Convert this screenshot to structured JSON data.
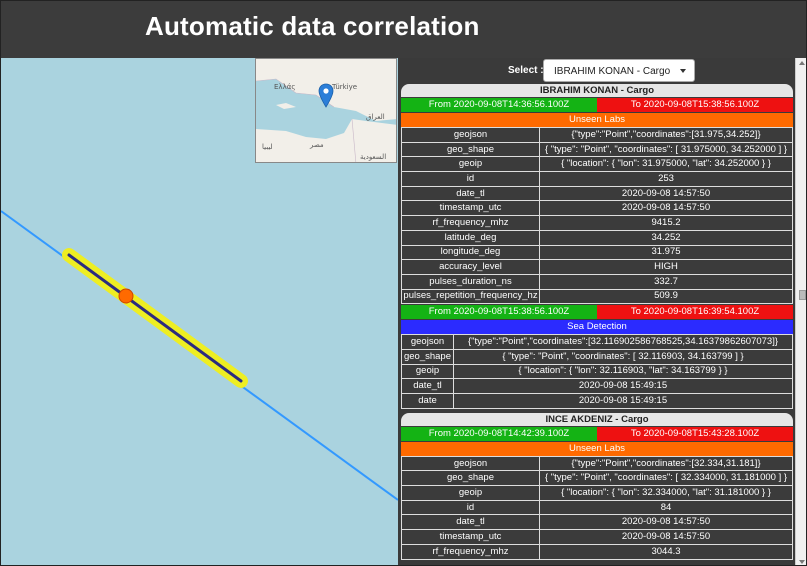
{
  "title": "Automatic data correlation",
  "select": {
    "label": "Select :",
    "value": "IBRAHIM KONAN - Cargo"
  },
  "inset_labels": {
    "greece": "Ελλάς",
    "turkey": "Türkiye",
    "iraq": "العراق",
    "libya": "ليبيا",
    "egypt": "مصر",
    "saudi": "السعودية"
  },
  "colors": {
    "from": "#14b314",
    "to": "#ee1111",
    "unseen_labs": "#ff6a00",
    "sea_detection": "#2b2bff",
    "track": "#3399ff"
  },
  "cards": [
    {
      "title": "IBRAHIM KONAN - Cargo",
      "from": "From 2020-09-08T14:36:56.100Z",
      "to": "To 2020-09-08T15:38:56.100Z",
      "source": "Unseen Labs",
      "rows": [
        [
          "geojson",
          "{\"type\":\"Point\",\"coordinates\":[31.975,34.252]}"
        ],
        [
          "geo_shape",
          "{ \"type\": \"Point\", \"coordinates\": [ 31.975000, 34.252000 ] }"
        ],
        [
          "geoip",
          "{ \"location\": { \"lon\": 31.975000, \"lat\": 34.252000 } }"
        ],
        [
          "id",
          "253"
        ],
        [
          "date_tl",
          "2020-09-08 14:57:50"
        ],
        [
          "timestamp_utc",
          "2020-09-08 14:57:50"
        ],
        [
          "rf_frequency_mhz",
          "9415.2"
        ],
        [
          "latitude_deg",
          "34.252"
        ],
        [
          "longitude_deg",
          "31.975"
        ],
        [
          "accuracy_level",
          "HIGH"
        ],
        [
          "pulses_duration_ns",
          "332.7"
        ],
        [
          "pulses_repetition_frequency_hz",
          "509.9"
        ]
      ],
      "from2": "From 2020-09-08T15:38:56.100Z",
      "to2": "To 2020-09-08T16:39:54.100Z",
      "source2": "Sea Detection",
      "rows2": [
        [
          "geojson",
          "{\"type\":\"Point\",\"coordinates\":[32.116902586768525,34.16379862607073]}"
        ],
        [
          "geo_shape",
          "{ \"type\": \"Point\", \"coordinates\": [ 32.116903, 34.163799 ] }"
        ],
        [
          "geoip",
          "{ \"location\": { \"lon\": 32.116903, \"lat\": 34.163799 } }"
        ],
        [
          "date_tl",
          "2020-09-08 15:49:15"
        ],
        [
          "date",
          "2020-09-08 15:49:15"
        ]
      ]
    },
    {
      "title": "INCE AKDENIZ - Cargo",
      "from": "From 2020-09-08T14:42:39.100Z",
      "to": "To 2020-09-08T15:43:28.100Z",
      "source": "Unseen Labs",
      "rows": [
        [
          "geojson",
          "{\"type\":\"Point\",\"coordinates\":[32.334,31.181]}"
        ],
        [
          "geo_shape",
          "{ \"type\": \"Point\", \"coordinates\": [ 32.334000, 31.181000 ] }"
        ],
        [
          "geoip",
          "{ \"location\": { \"lon\": 32.334000, \"lat\": 31.181000 } }"
        ],
        [
          "id",
          "84"
        ],
        [
          "date_tl",
          "2020-09-08 14:57:50"
        ],
        [
          "timestamp_utc",
          "2020-09-08 14:57:50"
        ],
        [
          "rf_frequency_mhz",
          "3044.3"
        ]
      ]
    }
  ]
}
